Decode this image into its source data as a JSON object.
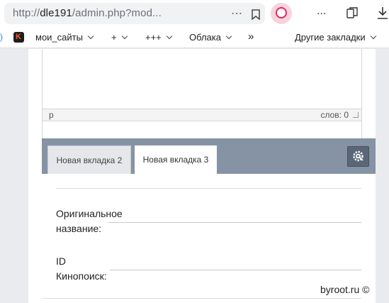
{
  "browser": {
    "url_prefix": "http://",
    "url_host": "dle191",
    "url_path": "/admin.php?mod...",
    "more_dots": "⋯",
    "menu_dots": "..."
  },
  "bookmarks": {
    "items": [
      {
        "label": "мои_сайты"
      },
      {
        "label": "+"
      },
      {
        "label": "+++"
      },
      {
        "label": "Облака"
      }
    ],
    "overflow": "»",
    "other": "Другие закладки"
  },
  "editor": {
    "path_tag": "p",
    "word_count": "слов: 0"
  },
  "tabs": [
    {
      "label": "Новая вкладка 2",
      "active": false
    },
    {
      "label": "Новая вкладка 3",
      "active": true
    }
  ],
  "form": {
    "original_title_label_1": "Оригинальное",
    "original_title_label_2": "название:",
    "kp_id_label_1": "ID",
    "kp_id_label_2": "Кинопоиск:"
  },
  "watermark": "byroot.ru ©",
  "colors": {
    "tabstrip": "#8593a5",
    "alice": "#e8225c",
    "gear_button": "#5b6778"
  }
}
